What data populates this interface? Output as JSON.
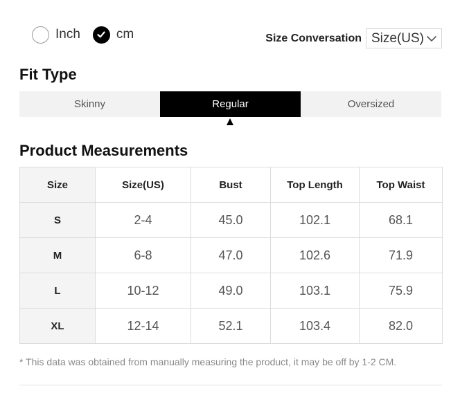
{
  "units": {
    "options": [
      {
        "label": "Inch",
        "checked": false
      },
      {
        "label": "cm",
        "checked": true
      }
    ],
    "check_icon": "checkmark-icon"
  },
  "size_conversion": {
    "label": "Size Conversation",
    "selected": "Size(US)",
    "dropdown_icon": "chevron-down-icon"
  },
  "fit_type": {
    "title": "Fit Type",
    "tabs": [
      "Skinny",
      "Regular",
      "Oversized"
    ],
    "active_index": 1,
    "pointer_icon": "triangle-up-icon"
  },
  "measurements": {
    "title": "Product Measurements",
    "headers": [
      "Size",
      "Size(US)",
      "Bust",
      "Top Length",
      "Top Waist"
    ],
    "rows": [
      [
        "S",
        "2-4",
        "45.0",
        "102.1",
        "68.1"
      ],
      [
        "M",
        "6-8",
        "47.0",
        "102.6",
        "71.9"
      ],
      [
        "L",
        "10-12",
        "49.0",
        "103.1",
        "75.9"
      ],
      [
        "XL",
        "12-14",
        "52.1",
        "103.4",
        "82.0"
      ]
    ]
  },
  "note": "* This data was obtained from manually measuring the product, it may be off by 1-2 CM.",
  "colors": {
    "accent": "#000000",
    "tab_bg": "#f2f2f2",
    "border": "#dcdcdc",
    "size_col_bg": "#f4f4f4",
    "note_text": "#888888"
  }
}
